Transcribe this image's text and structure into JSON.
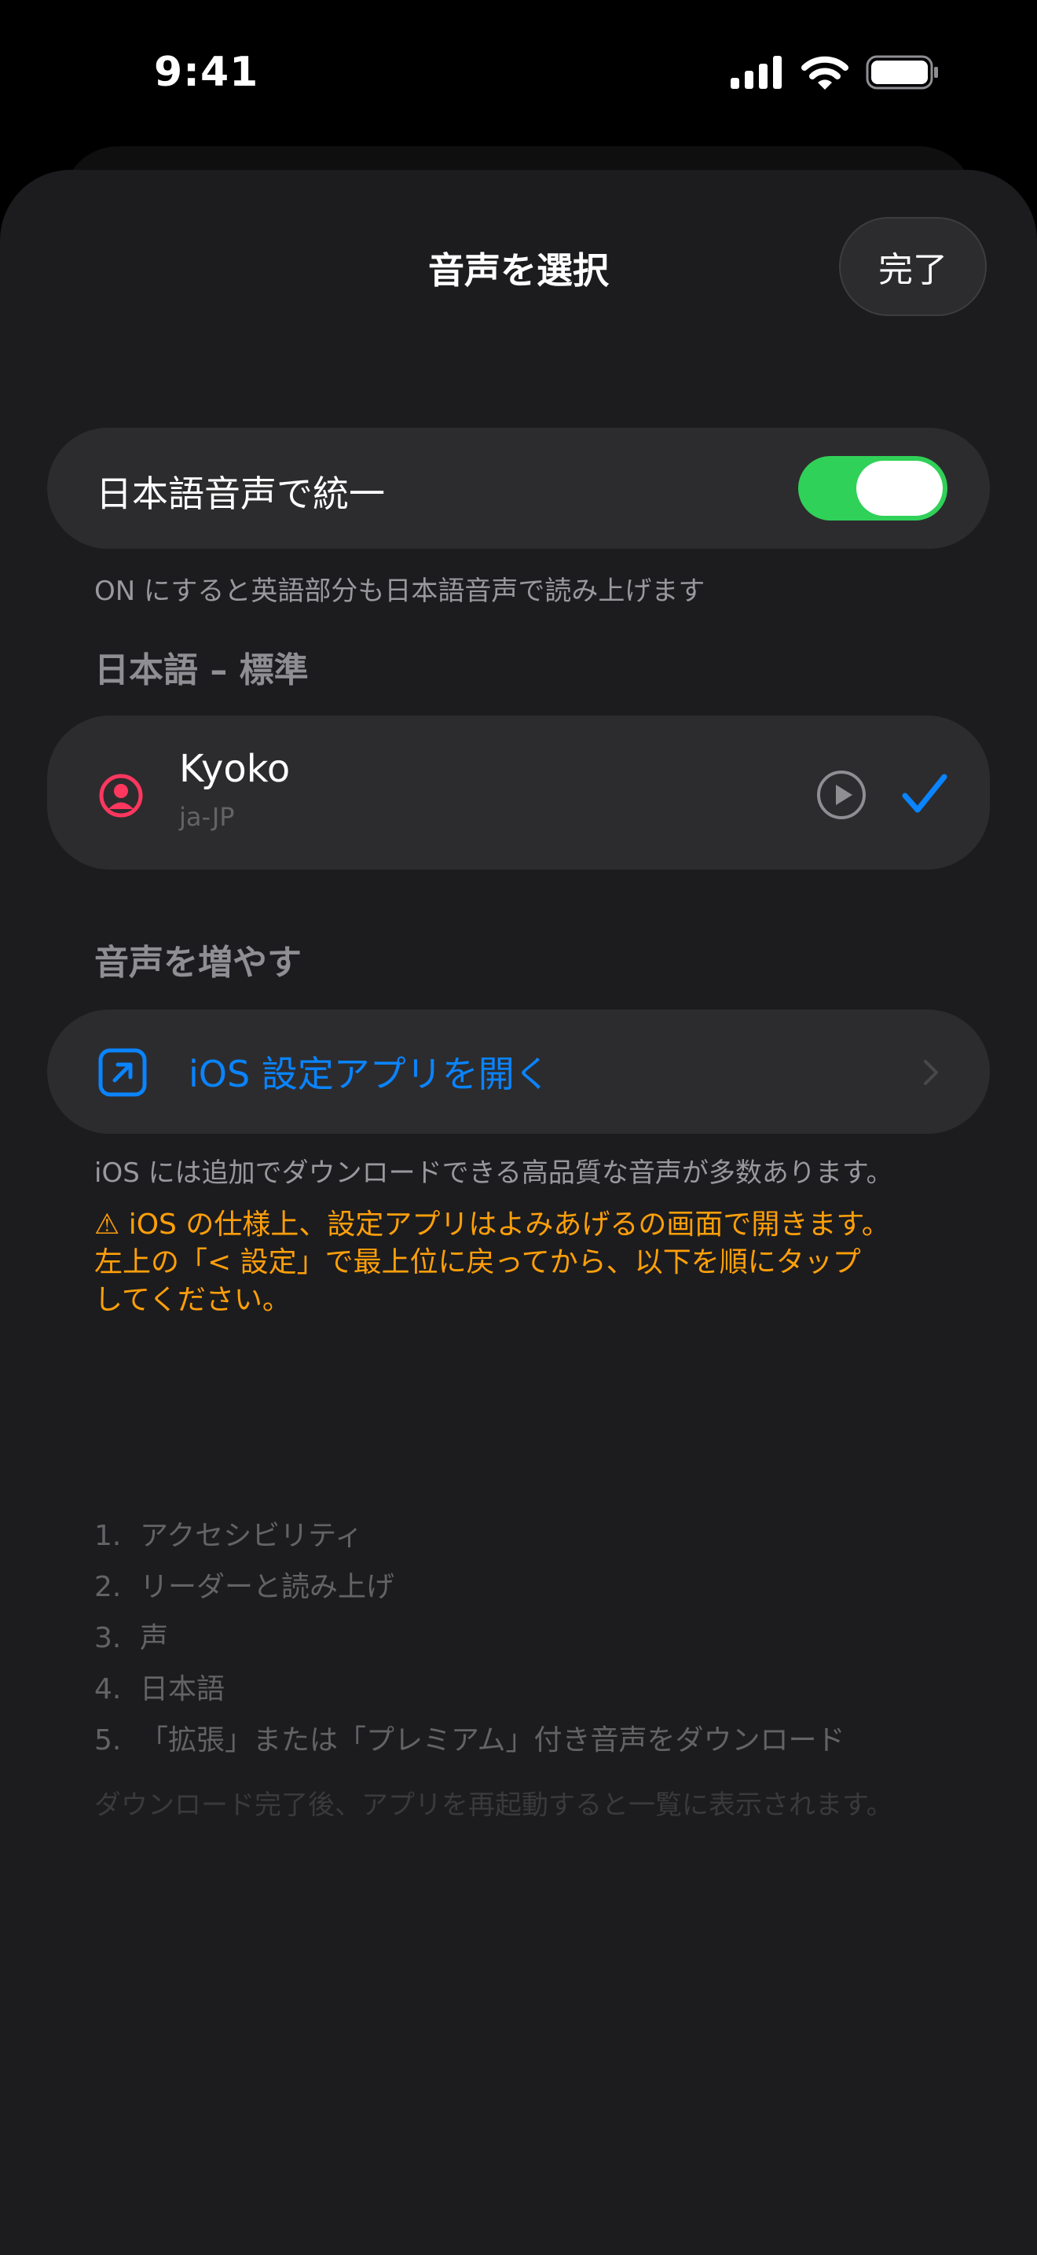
{
  "status_bar": {
    "time": "9:41"
  },
  "sheet": {
    "title": "音声を選択",
    "done_label": "完了"
  },
  "unify_toggle": {
    "label": "日本語音声で統一",
    "enabled": true,
    "note": "ON にすると英語部分も日本語音声で読み上げます"
  },
  "japanese_section": {
    "header": "日本語 – 標準",
    "voices": [
      {
        "name": "Kyoko",
        "locale": "ja-JP",
        "selected": true,
        "icon": "person-circle-icon"
      }
    ]
  },
  "add_voices_section": {
    "header": "音声を増やす",
    "open_settings_label": "iOS 設定アプリを開く",
    "description": "iOS には追加でダウンロードできる高品質な音声が多数あります。",
    "warning_lines": [
      "⚠ iOS の仕様上、設定アプリはよみあげるの画面で開きます。",
      "左上の「< 設定」で最上位に戻ってから、以下を順にタップ",
      "してください。"
    ],
    "steps": [
      {
        "num": "1.",
        "text": "アクセシビリティ"
      },
      {
        "num": "2.",
        "text": "リーダーと読み上げ"
      },
      {
        "num": "3.",
        "text": "声"
      },
      {
        "num": "4.",
        "text": "日本語"
      },
      {
        "num": "5.",
        "text": "「拡張」または「プレミアム」付き音声をダウンロード"
      }
    ],
    "footer_note": "ダウンロード完了後、アプリを再起動すると一覧に表示されます。"
  },
  "colors": {
    "background": "#000000",
    "sheet": "#1c1c1e",
    "card": "#2c2c2e",
    "accent_blue": "#0a84ff",
    "toggle_on": "#30d158",
    "warning": "#ff9f0a",
    "avatar_pink": "#ff375f",
    "secondary_text": "#98989d"
  }
}
